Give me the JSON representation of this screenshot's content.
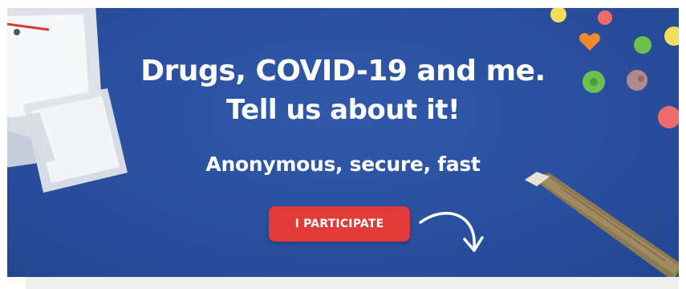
{
  "banner": {
    "headline_line1": "Drugs, COVID-19 and me.",
    "headline_line2": "Tell us about it!",
    "subheadline": "Anonymous, secure, fast",
    "cta_label": "I PARTICIPATE"
  },
  "colors": {
    "background": "#2a4f9f",
    "cta": "#e23a36",
    "text": "#ffffff"
  },
  "icons": [
    "curved-arrow-icon"
  ]
}
